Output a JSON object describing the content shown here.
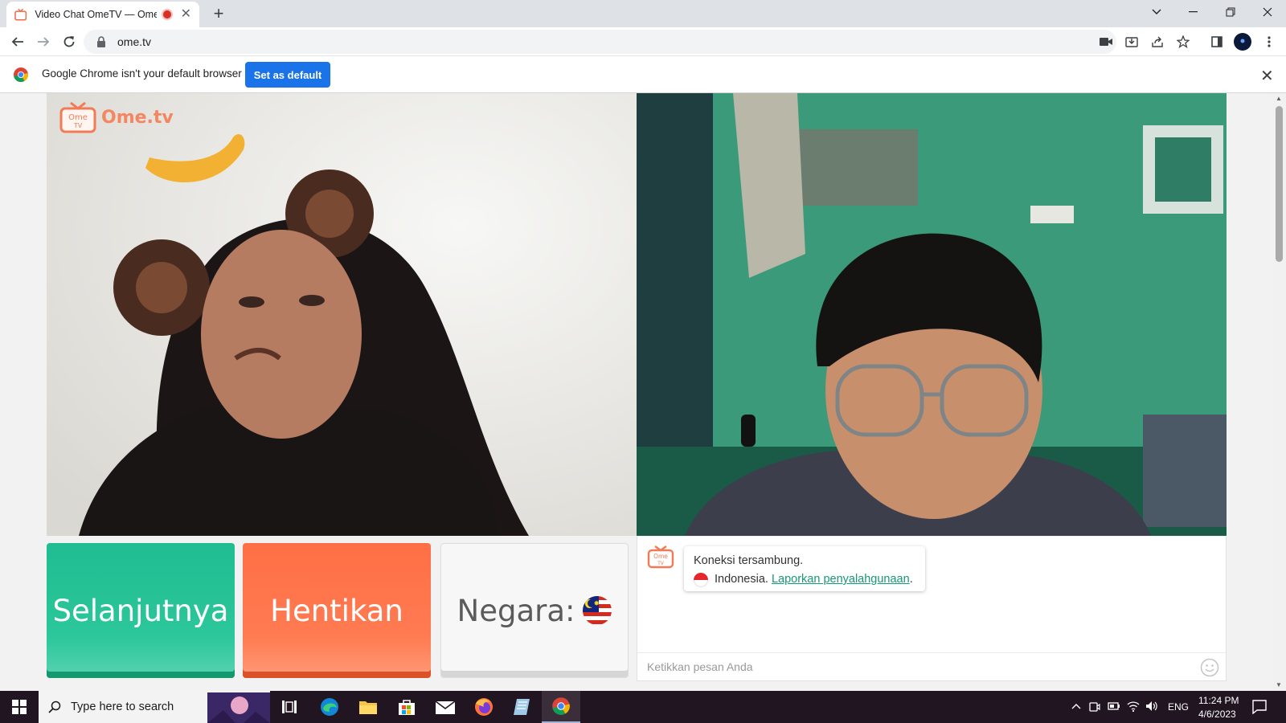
{
  "browser": {
    "tab_title": "Video Chat OmeTV — Omegle",
    "url": "ome.tv",
    "infobar_text": "Google Chrome isn't your default browser",
    "set_default_label": "Set as default"
  },
  "page": {
    "logo_text": "Ome.tv",
    "buttons": {
      "next": "Selanjutnya",
      "stop": "Hentikan",
      "country": "Negara:"
    },
    "chat": {
      "status": "Koneksi tersambung.",
      "country": "Indonesia.",
      "report_link": "Laporkan penyalahgunaan",
      "report_suffix": ".",
      "input_placeholder": "Ketikkan pesan Anda"
    }
  },
  "taskbar": {
    "search_placeholder": "Type here to search",
    "language": "ENG",
    "time": "11:24 PM",
    "date": "4/6/2023"
  }
}
